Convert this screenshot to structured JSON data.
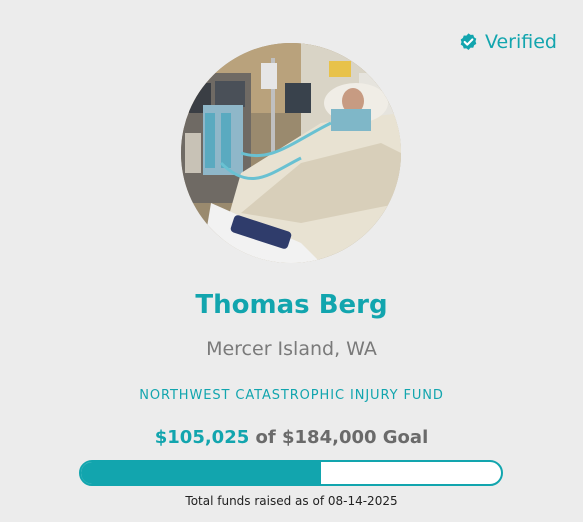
{
  "verified": {
    "label": "Verified",
    "icon": "verified-check-badge-icon"
  },
  "profile": {
    "photo": "hospital-bed-photo",
    "name": "Thomas Berg",
    "location": "Mercer Island, WA"
  },
  "fund": {
    "name": "NORTHWEST CATASTROPHIC INJURY FUND",
    "raised": "$105,025",
    "goal_text": "of $184,000 Goal",
    "progress_fraction": 0.571,
    "as_of": "Total funds raised as of 08-14-2025"
  },
  "colors": {
    "accent": "#12a5ae",
    "background": "#ececec",
    "muted_text": "#7a7a7a"
  }
}
